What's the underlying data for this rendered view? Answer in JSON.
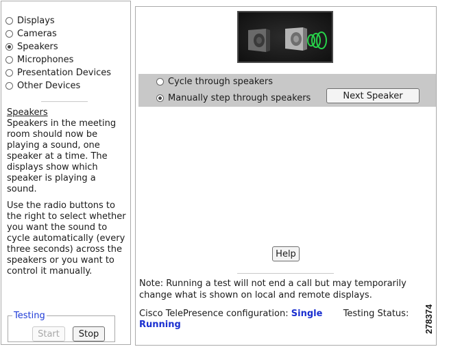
{
  "device_nav": {
    "items": [
      {
        "label": "Displays",
        "selected": false
      },
      {
        "label": "Cameras",
        "selected": false
      },
      {
        "label": "Speakers",
        "selected": true
      },
      {
        "label": "Microphones",
        "selected": false
      },
      {
        "label": "Presentation Devices",
        "selected": false
      },
      {
        "label": "Other Devices",
        "selected": false
      }
    ]
  },
  "help": {
    "heading": "Speakers",
    "paragraph1": "Speakers in the meeting room should now be playing a sound, one speaker at a time. The displays show which speaker is playing a sound.",
    "paragraph2": "Use the radio buttons to the right to select whether you want the sound to cycle automatically (every three seconds) across the speakers or you want to control it manually."
  },
  "testing": {
    "legend": "Testing",
    "start_label": "Start",
    "start_enabled": false,
    "stop_label": "Stop"
  },
  "speaker_mode": {
    "options": [
      {
        "label": "Cycle through speakers",
        "selected": false
      },
      {
        "label": "Manually step through speakers",
        "selected": true
      }
    ],
    "next_label": "Next Speaker"
  },
  "help_button_label": "Help",
  "note": "Note: Running a test will not end a call but may temporarily change what is shown on local and remote displays.",
  "status": {
    "config_label": "Cisco TelePresence configuration:",
    "config_value": "Single",
    "testing_label": "Testing Status:",
    "testing_value": "Running"
  },
  "figure_number": "278374",
  "colors": {
    "status_value": "#1a2fd0",
    "mode_band": "#c8c8c8"
  }
}
